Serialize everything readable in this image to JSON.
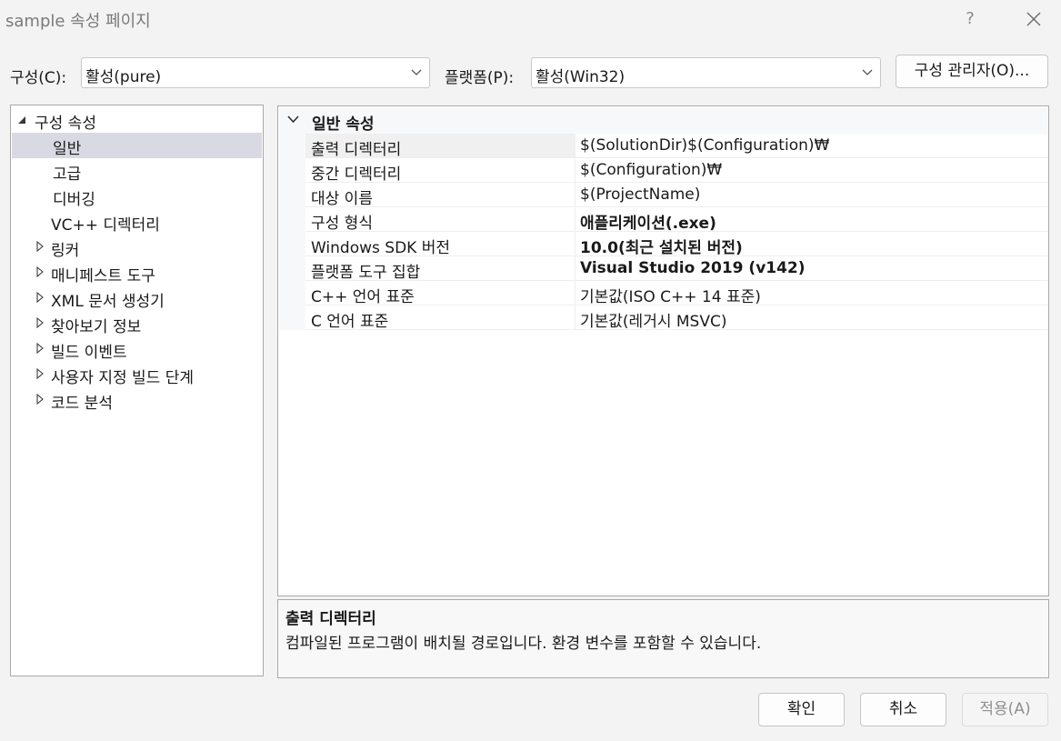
{
  "window": {
    "title": "sample 속성 페이지",
    "help_label": "?"
  },
  "toolbar": {
    "config_label": "구성(C):",
    "config_value": "활성(pure)",
    "platform_label": "플랫폼(P):",
    "platform_value": "활성(Win32)",
    "config_manager_label": "구성 관리자(O)..."
  },
  "tree": {
    "root": "구성 속성",
    "items": [
      {
        "label": "일반",
        "selected": true
      },
      {
        "label": "고급"
      },
      {
        "label": "디버깅"
      },
      {
        "label": "VC++ 디렉터리"
      },
      {
        "label": "링커",
        "expandable": true
      },
      {
        "label": "매니페스트 도구",
        "expandable": true
      },
      {
        "label": "XML 문서 생성기",
        "expandable": true
      },
      {
        "label": "찾아보기 정보",
        "expandable": true
      },
      {
        "label": "빌드 이벤트",
        "expandable": true
      },
      {
        "label": "사용자 지정 빌드 단계",
        "expandable": true
      },
      {
        "label": "코드 분석",
        "expandable": true
      }
    ]
  },
  "grid": {
    "section": "일반 속성",
    "rows": [
      {
        "name": "출력 디렉터리",
        "value": "$(SolutionDir)$(Configuration)₩",
        "bold": false
      },
      {
        "name": "중간 디렉터리",
        "value": "$(Configuration)₩",
        "bold": false
      },
      {
        "name": "대상 이름",
        "value": "$(ProjectName)",
        "bold": false
      },
      {
        "name": "구성 형식",
        "value": "애플리케이션(.exe)",
        "bold": true
      },
      {
        "name": "Windows SDK 버전",
        "value": "10.0(최근 설치된 버전)",
        "bold": true
      },
      {
        "name": "플랫폼 도구 집합",
        "value": "Visual Studio 2019 (v142)",
        "bold": true
      },
      {
        "name": "C++ 언어 표준",
        "value": "기본값(ISO C++ 14 표준)",
        "bold": false
      },
      {
        "name": "C 언어 표준",
        "value": "기본값(레거시 MSVC)",
        "bold": false
      }
    ]
  },
  "description": {
    "title": "출력 디렉터리",
    "text": "컴파일된 프로그램이 배치될 경로입니다. 환경 변수를 포함할 수 있습니다."
  },
  "buttons": {
    "ok": "확인",
    "cancel": "취소",
    "apply": "적용(A)"
  },
  "colors": {
    "selection": "#d9d9e3",
    "window_bg": "#f3f3f3",
    "border": "#a9a9a9",
    "disabled_text": "#8f8f8f"
  },
  "icons": {
    "close": "close-icon",
    "combo_arrow": "chevron-down-icon",
    "tree_expanded": "triangle-down-icon",
    "tree_collapsed": "triangle-right-icon",
    "section_collapse": "chevron-down-icon"
  }
}
